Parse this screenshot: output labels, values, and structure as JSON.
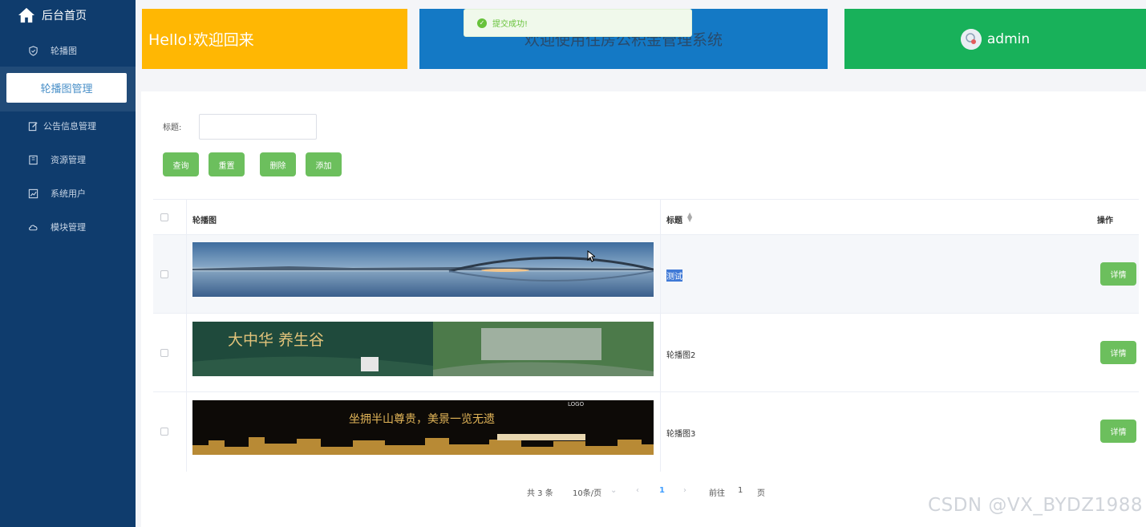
{
  "sidebar": {
    "home_label": "后台首页",
    "items": [
      {
        "label": "轮播图",
        "icon": "shield-icon"
      },
      {
        "label": "公告信息管理",
        "icon": "edit-icon"
      },
      {
        "label": "资源管理",
        "icon": "book-icon"
      },
      {
        "label": "系统用户",
        "icon": "chart-icon"
      },
      {
        "label": "模块管理",
        "icon": "cloud-icon"
      }
    ],
    "active_sub": "轮播图管理"
  },
  "header": {
    "welcome": "Hello!欢迎回来",
    "system_title": "欢迎使用住房公积金管理系统",
    "username": "admin"
  },
  "toast": {
    "message": "提交成功!",
    "icon": "check-icon"
  },
  "search": {
    "label": "标题:",
    "value": ""
  },
  "buttons": {
    "query": "查询",
    "reset": "重置",
    "delete": "删除",
    "add": "添加"
  },
  "table": {
    "columns": [
      "轮播图",
      "标题",
      "操作"
    ],
    "rows": [
      {
        "title": "测试",
        "action": "详情",
        "selected_text": true
      },
      {
        "title": "轮播图2",
        "action": "详情"
      },
      {
        "title": "轮播图3",
        "action": "详情"
      }
    ],
    "banner2_text": "大中华 养生谷",
    "banner3_logo": "LOGO",
    "banner3_text": "坐拥半山尊贵，美景一览无遗"
  },
  "pagination": {
    "total": "共 3 条",
    "page_size": "10条/页",
    "current": "1",
    "goto_label": "前往",
    "goto_value": "1",
    "page_suffix": "页"
  },
  "watermark": "CSDN @VX_BYDZ1988",
  "colors": {
    "sidebar": "#0f3c6d",
    "yellow": "#ffb703",
    "blue": "#1479c5",
    "green": "#18b15a",
    "button": "#6cbf5d"
  }
}
